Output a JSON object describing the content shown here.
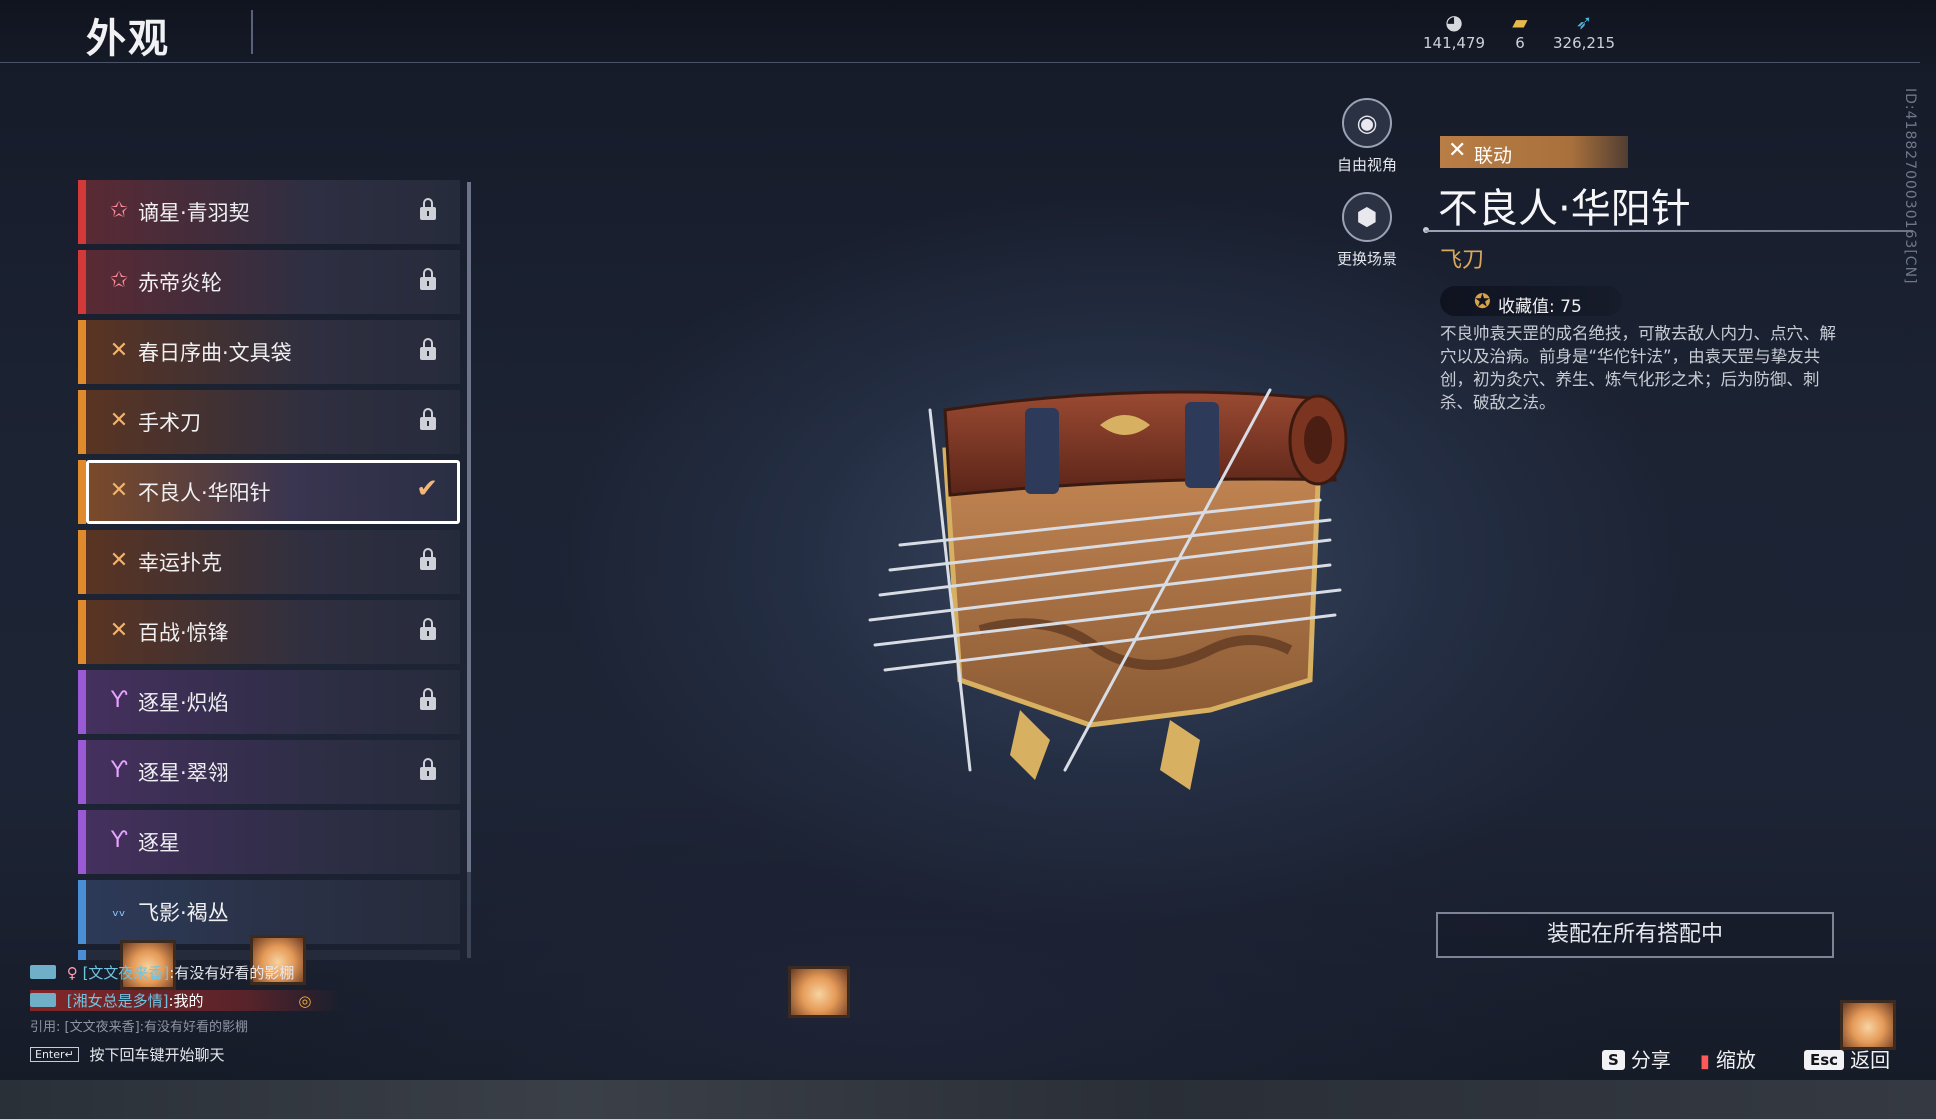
{
  "header": {
    "title": "外观",
    "currencies": [
      {
        "icon": "coin-icon",
        "value": "141,479"
      },
      {
        "icon": "ticket-icon",
        "value": "6"
      },
      {
        "icon": "feather-icon",
        "value": "326,215"
      }
    ]
  },
  "list": {
    "items": [
      {
        "label": "谪星·青羽契",
        "icon": "star-icon",
        "rarity_color": "#d23a3a",
        "state": "locked"
      },
      {
        "label": "赤帝炎轮",
        "icon": "star-icon",
        "rarity_color": "#d23a3a",
        "state": "locked"
      },
      {
        "label": "春日序曲·文具袋",
        "icon": "crossed-blades-icon",
        "rarity_color": "#e08a2e",
        "state": "locked"
      },
      {
        "label": "手术刀",
        "icon": "crossed-blades-icon",
        "rarity_color": "#e08a2e",
        "state": "locked"
      },
      {
        "label": "不良人·华阳针",
        "icon": "crossed-blades-icon",
        "rarity_color": "#e08a2e",
        "state": "equipped"
      },
      {
        "label": "幸运扑克",
        "icon": "crossed-blades-icon",
        "rarity_color": "#e08a2e",
        "state": "locked"
      },
      {
        "label": "百战·惊锋",
        "icon": "crossed-blades-icon",
        "rarity_color": "#e08a2e",
        "state": "locked"
      },
      {
        "label": "逐星·炽焰",
        "icon": "wings-icon",
        "rarity_color": "#9a5ad6",
        "state": "locked"
      },
      {
        "label": "逐星·翠翎",
        "icon": "wings-icon",
        "rarity_color": "#9a5ad6",
        "state": "locked"
      },
      {
        "label": "逐星",
        "icon": "wings-icon",
        "rarity_color": "#9a5ad6",
        "state": "unlocked"
      },
      {
        "label": "飞影·褐丛",
        "icon": "small-wings-icon",
        "rarity_color": "#4a8fd6",
        "state": "unlocked"
      }
    ]
  },
  "camera": {
    "free_view": "自由视角",
    "change_scene": "更换场景"
  },
  "detail": {
    "tag": "联动",
    "name": "不良人·华阳针",
    "type": "飞刀",
    "collection_label": "收藏值: 75",
    "description": "不良帅袁天罡的成名绝技，可散去敌人内力、点穴、解穴以及治病。前身是“华佗针法”，由袁天罡与挚友共创，初为灸穴、养生、炼气化形之术；后为防御、刺杀、破敌之法。",
    "equip_all": "装配在所有搭配中",
    "id_text": "ID:41882700030163[CN]"
  },
  "chat": {
    "line1_prefix": "[文文夜来香]",
    "line1_text": ":有没有好看的影棚",
    "line2_prefix": "[湘女总是多情]",
    "line2_text": ":我的",
    "quote": "引用: [文文夜来香]:有没有好看的影棚",
    "enter_key": "Enter↵",
    "enter_hint": "按下回车键开始聊天"
  },
  "hotkeys": {
    "share_key": "S",
    "share": "分享",
    "zoom": "缩放",
    "back_key": "Esc",
    "back": "返回"
  },
  "colors": {
    "accent_gold": "#d9a95b",
    "tag_bg": "#b97e45"
  }
}
